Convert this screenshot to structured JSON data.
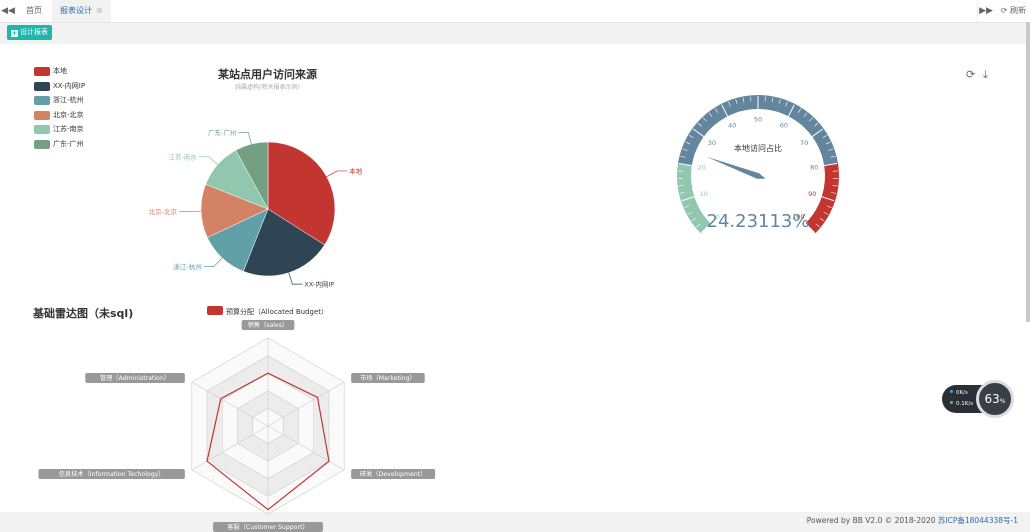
{
  "tabs": {
    "home": "首页",
    "active": "报表设计",
    "close": "⊗"
  },
  "toolbar": {
    "refresh": "刷新",
    "design_button": "设计报表"
  },
  "pie": {
    "title": "某站点用户访问来源",
    "subtitle": "纯属虚构(积木报表示例)",
    "legend": [
      {
        "name": "本地",
        "color": "#c23531"
      },
      {
        "name": "XX-内网IP",
        "color": "#2f4554"
      },
      {
        "name": "浙江-杭州",
        "color": "#61a0a8"
      },
      {
        "name": "北京-北京",
        "color": "#d48265"
      },
      {
        "name": "江苏-南京",
        "color": "#91c7ae"
      },
      {
        "name": "广东-广州",
        "color": "#749f83"
      }
    ]
  },
  "chart_data": [
    {
      "type": "pie",
      "title": "某站点用户访问来源",
      "subtitle": "纯属虚构(积木报表示例)",
      "categories": [
        "本地",
        "XX-内网IP",
        "浙江-杭州",
        "北京-北京",
        "江苏-南京",
        "广东-广州"
      ],
      "values": [
        34,
        22,
        12,
        13,
        11,
        8
      ],
      "colors": [
        "#c23531",
        "#2f4554",
        "#61a0a8",
        "#d48265",
        "#91c7ae",
        "#749f83"
      ],
      "legend_position": "top-left"
    },
    {
      "type": "gauge",
      "title": "本地访问占比",
      "value": 24.23113,
      "value_label": "24.23113%",
      "range": [
        0,
        100
      ],
      "ticks": [
        "0",
        "10",
        "20",
        "30",
        "40",
        "50",
        "60",
        "70",
        "80",
        "90",
        "100"
      ],
      "bands": [
        {
          "to": 0.2,
          "color": "#91c7ae"
        },
        {
          "to": 0.8,
          "color": "#63869e"
        },
        {
          "to": 1.0,
          "color": "#c23531"
        }
      ]
    },
    {
      "type": "radar",
      "title": "基础雷达图（未sql)",
      "indicators": [
        "销售（sales）",
        "市场（Marketing）",
        "研发（Development）",
        "客服（Customer Support）",
        "信息技术（Information Techology）",
        "管理（Administration）"
      ],
      "series": [
        {
          "name": "预算分配（Allocated Budget）",
          "values": [
            0.6,
            0.65,
            0.8,
            0.95,
            0.8,
            0.62
          ]
        }
      ],
      "series_color": "#c23531",
      "legend_position": "top"
    }
  ],
  "widget": {
    "up": "0K/s",
    "down": "0.1K/s",
    "percent": "63",
    "percent_unit": "%"
  },
  "footer": {
    "text": "Powered by BB V2.0 © 2018-2020 ",
    "icp": "苏ICP备18044338号-1"
  }
}
